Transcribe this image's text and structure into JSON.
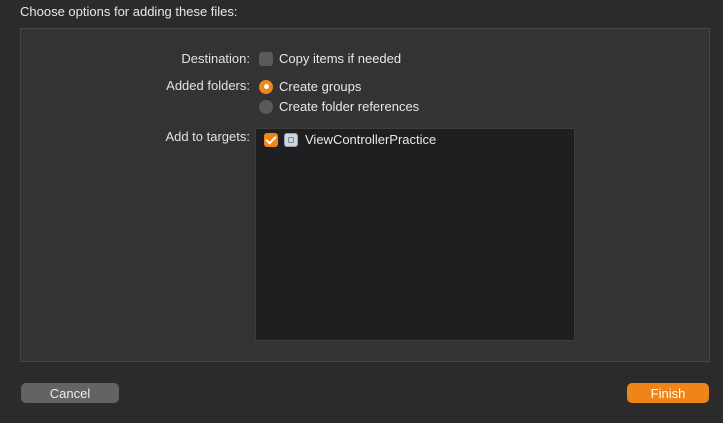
{
  "header": {
    "title": "Choose options for adding these files:"
  },
  "destination": {
    "label": "Destination:",
    "copy_items": {
      "label": "Copy items if needed",
      "checked": false
    }
  },
  "added_folders": {
    "label": "Added folders:",
    "options": [
      {
        "label": "Create groups",
        "selected": true
      },
      {
        "label": "Create folder references",
        "selected": false
      }
    ]
  },
  "targets": {
    "label": "Add to targets:",
    "items": [
      {
        "label": "ViewControllerPractice",
        "checked": true,
        "icon": "app-target-icon"
      }
    ]
  },
  "buttons": {
    "cancel": "Cancel",
    "finish": "Finish"
  },
  "colors": {
    "accent": "#ef8418",
    "background": "#2b2b2b",
    "panel": "#333333",
    "list_background": "#1f1f21"
  }
}
